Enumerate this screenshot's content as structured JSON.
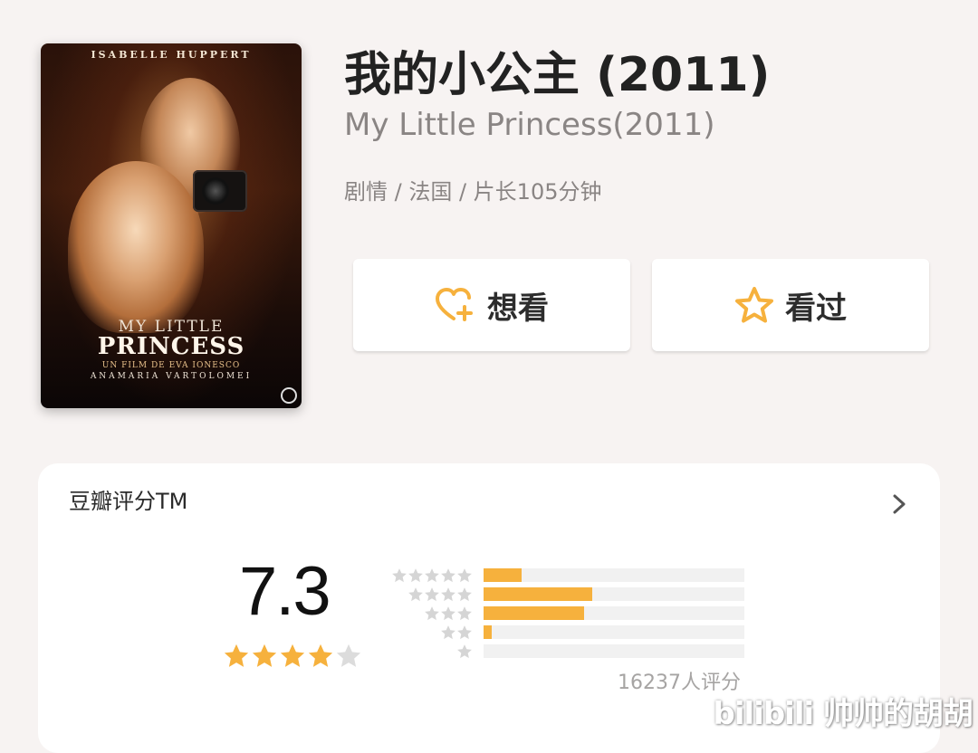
{
  "movie": {
    "title": "我的小公主 (2011)",
    "original_title": "My Little Princess(2011)",
    "meta": "剧情 / 法国 / 片长105分钟",
    "poster": {
      "top_credit": "ISABELLE HUPPERT",
      "title_line1": "MY LITTLE",
      "title_line2": "PRINCESS",
      "subtitle": "UN FILM DE EVA IONESCO",
      "actor": "ANAMARIA VARTOLOMEI"
    }
  },
  "actions": {
    "want_label": "想看",
    "seen_label": "看过",
    "want_icon": "heart-plus-icon",
    "seen_icon": "star-outline-icon"
  },
  "rating": {
    "section_title": "豆瓣评分TM",
    "score": "7.3",
    "stars": 4,
    "max_stars": 5,
    "distribution": [
      {
        "stars": 5,
        "fraction": 0.145
      },
      {
        "stars": 4,
        "fraction": 0.415
      },
      {
        "stars": 3,
        "fraction": 0.385
      },
      {
        "stars": 2,
        "fraction": 0.03
      },
      {
        "stars": 1,
        "fraction": 0.0
      }
    ],
    "count_label": "16237人评分"
  },
  "colors": {
    "accent": "#f6b13d",
    "page_bg": "#f7f3f2",
    "muted_text": "#8a8584",
    "star_empty": "#dcdcdc"
  },
  "watermark": "bilibili 帅帅的胡胡"
}
